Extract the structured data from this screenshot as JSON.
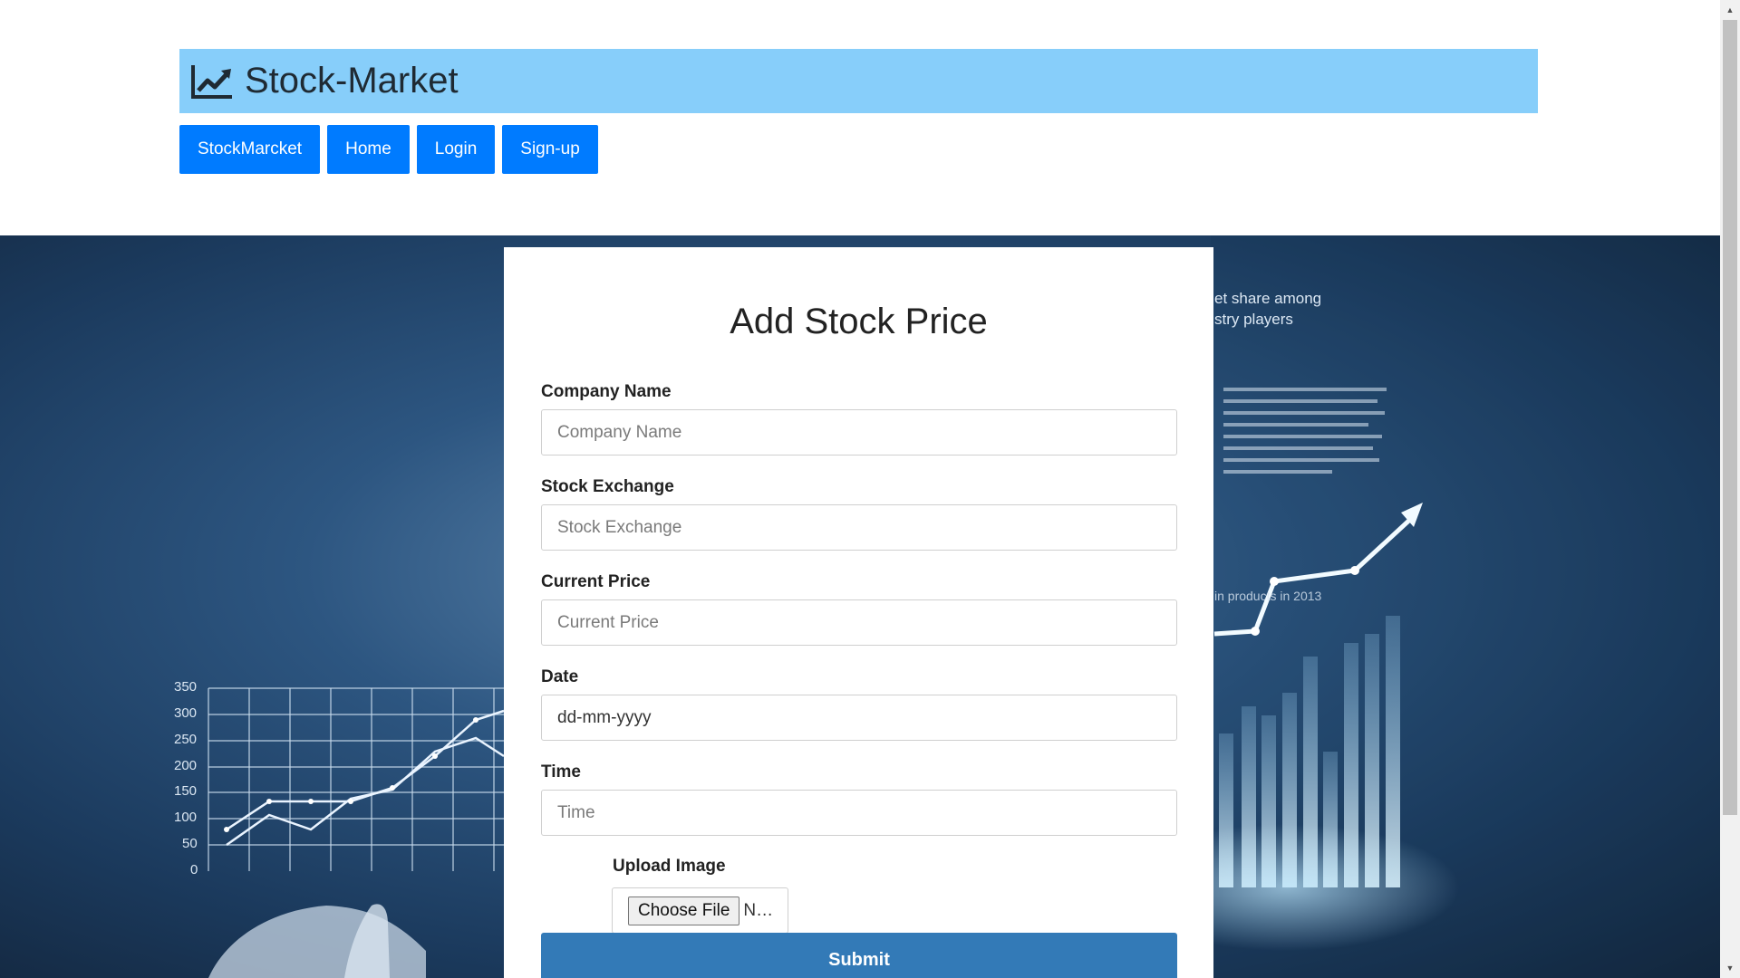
{
  "header": {
    "brand_title": "Stock-Market",
    "brand_icon": "line-chart-icon"
  },
  "nav": {
    "items": [
      {
        "label": "StockMarcket"
      },
      {
        "label": "Home"
      },
      {
        "label": "Login"
      },
      {
        "label": "Sign-up"
      }
    ]
  },
  "hero": {
    "text_top": "et share among",
    "text_top2": "stry players",
    "text_mid": "in products in 2013",
    "axis_ticks": [
      "350",
      "300",
      "250",
      "200",
      "150",
      "100",
      "50",
      "0"
    ]
  },
  "form": {
    "title": "Add Stock Price",
    "company_name": {
      "label": "Company Name",
      "placeholder": "Company Name"
    },
    "stock_exchange": {
      "label": "Stock Exchange",
      "placeholder": "Stock Exchange"
    },
    "current_price": {
      "label": "Current Price",
      "placeholder": "Current Price"
    },
    "date": {
      "label": "Date",
      "value": "dd-mm-yyyy"
    },
    "time": {
      "label": "Time",
      "placeholder": "Time"
    },
    "upload": {
      "label": "Upload Image",
      "button": "Choose File",
      "status": "N…"
    },
    "submit": "Submit"
  },
  "colors": {
    "brand_bar": "#87cefa",
    "nav_button": "#007bff",
    "submit_button": "#337ab7"
  }
}
